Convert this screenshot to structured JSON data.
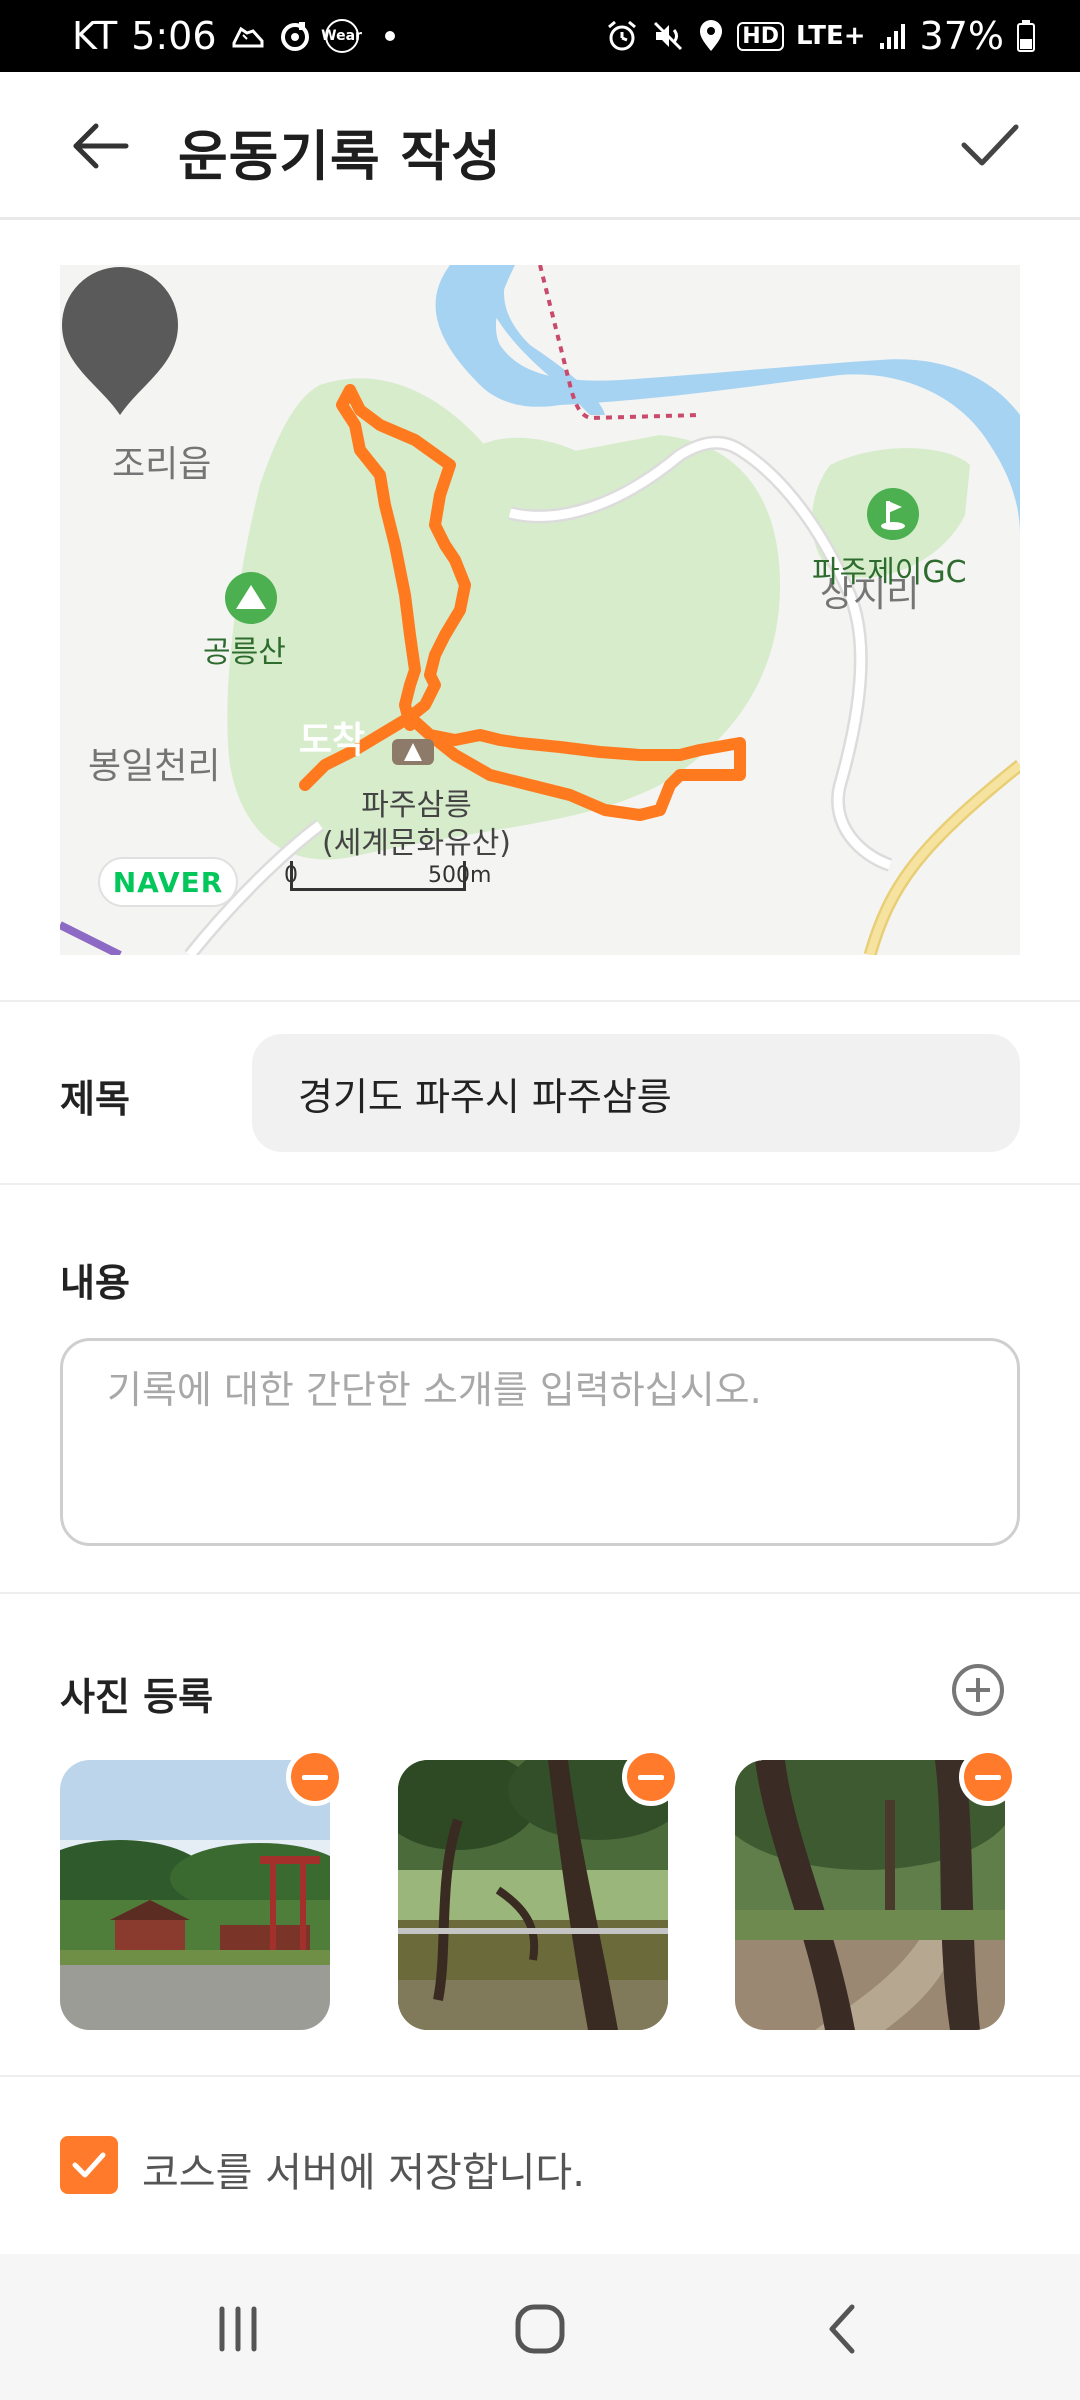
{
  "status_bar": {
    "carrier": "KT",
    "time": "5:06",
    "app_badge": "Wear",
    "network": "LTE+",
    "hd_label": "HD",
    "battery": "37%",
    "icons": [
      "running-shoe-icon",
      "app-circle-icon",
      "wear-icon",
      "notification-dot",
      "alarm-icon",
      "mute-icon",
      "location-icon",
      "hd-icon",
      "lte-icon",
      "signal-icon",
      "battery-icon"
    ]
  },
  "app_bar": {
    "title": "운동기록 작성",
    "back_icon": "arrow-left-icon",
    "confirm_icon": "check-icon"
  },
  "map": {
    "place_labels": {
      "jori": "조리읍",
      "bongil": "봉일천리",
      "gongneung": "공릉산",
      "paju_gc": "파주제이GC",
      "sangji": "상지리",
      "samneung_1": "파주삼릉",
      "samneung_2": "(세계문화유산)"
    },
    "marker_label": "도착",
    "naver_logo": "NAVER",
    "scale_start": "0",
    "scale_end": "500m",
    "colors": {
      "route": "#ff7a1f",
      "water": "#a7d3f2",
      "park": "#d6eccb",
      "road": "#ffffff",
      "accent_road": "#f7df86"
    }
  },
  "form": {
    "title_label": "제목",
    "title_value": "경기도 파주시  파주삼릉",
    "content_label": "내용",
    "content_placeholder": "기록에 대한 간단한 소개를 입력하십시오.",
    "content_value": ""
  },
  "photos": {
    "label": "사진 등록",
    "add_icon": "plus-circle-icon",
    "remove_icon": "minus-circle-icon",
    "count": 3
  },
  "save_option": {
    "label": "코스를 서버에 저장합니다.",
    "checked": true
  },
  "nav_bar": {
    "icons": [
      "recent-apps-icon",
      "home-icon",
      "back-icon"
    ]
  },
  "accent_color": "#ff7a2a"
}
